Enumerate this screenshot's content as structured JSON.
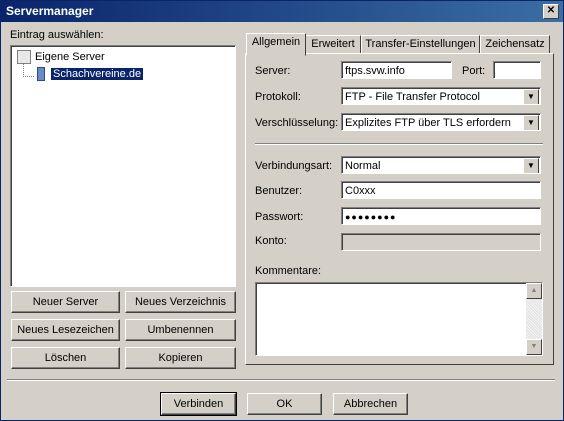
{
  "window": {
    "title": "Servermanager"
  },
  "left": {
    "label": "Eintrag auswählen:",
    "tree": {
      "root": "Eigene Server",
      "child": "Schachvereine.de"
    },
    "buttons": {
      "new_server": "Neuer Server",
      "new_folder": "Neues Verzeichnis",
      "new_bookmark": "Neues Lesezeichen",
      "rename": "Umbenennen",
      "delete": "Löschen",
      "copy": "Kopieren"
    }
  },
  "tabs": [
    "Allgemein",
    "Erweitert",
    "Transfer-Einstellungen",
    "Zeichensatz"
  ],
  "general": {
    "server_label": "Server:",
    "server_value": "ftps.svw.info",
    "port_label": "Port:",
    "port_value": "",
    "protocol_label": "Protokoll:",
    "protocol_value": "FTP - File Transfer Protocol",
    "encryption_label": "Verschlüsselung:",
    "encryption_value": "Explizites FTP über TLS erfordern",
    "logontype_label": "Verbindungsart:",
    "logontype_value": "Normal",
    "user_label": "Benutzer:",
    "user_value": "C0xxx",
    "password_label": "Passwort:",
    "password_value": "●●●●●●●●",
    "account_label": "Konto:",
    "comments_label": "Kommentare:"
  },
  "footer": {
    "connect": "Verbinden",
    "ok": "OK",
    "cancel": "Abbrechen"
  }
}
